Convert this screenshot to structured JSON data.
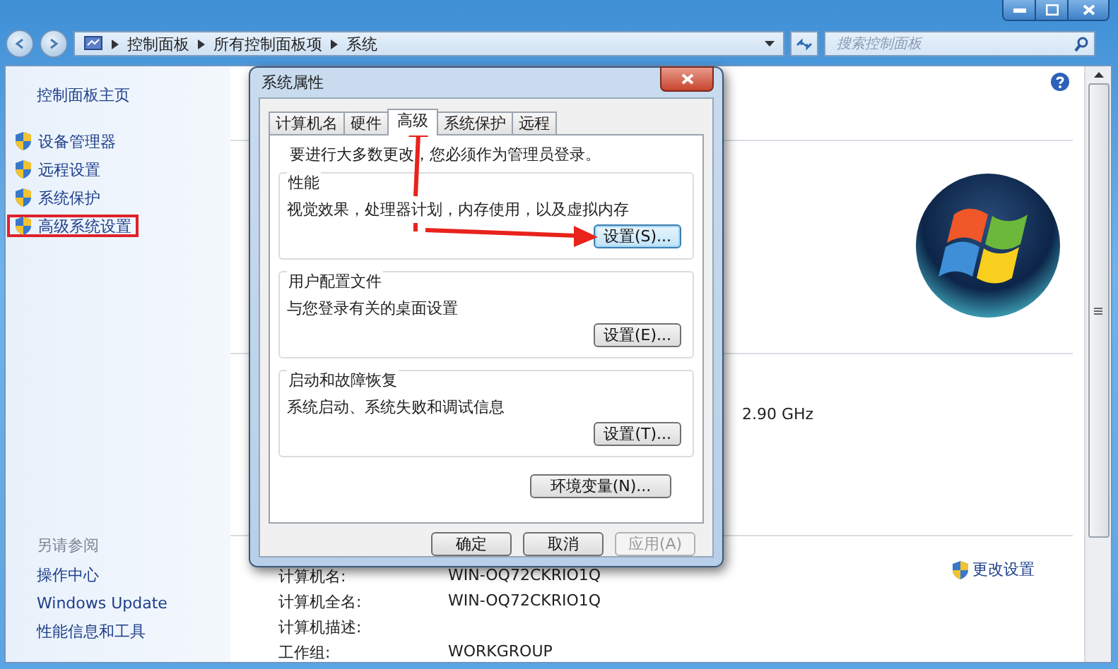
{
  "window": {
    "breadcrumb": [
      "控制面板",
      "所有控制面板项",
      "系统"
    ],
    "search": {
      "placeholder": "搜索控制面板"
    }
  },
  "sidebar": {
    "home": "控制面板主页",
    "items": [
      {
        "label": "设备管理器",
        "highlighted": false
      },
      {
        "label": "远程设置",
        "highlighted": false
      },
      {
        "label": "系统保护",
        "highlighted": false
      },
      {
        "label": "高级系统设置",
        "highlighted": true
      }
    ],
    "see_also": {
      "title": "另请参阅",
      "links": [
        "操作中心",
        "Windows Update",
        "性能信息和工具"
      ]
    }
  },
  "main": {
    "processor_speed": "2.90 GHz",
    "change_settings": "更改设置",
    "rows": [
      {
        "label": "计算机名:",
        "value": "WIN-OQ72CKRIO1Q"
      },
      {
        "label": "计算机全名:",
        "value": "WIN-OQ72CKRIO1Q"
      },
      {
        "label": "计算机描述:",
        "value": ""
      },
      {
        "label": "工作组:",
        "value": "WORKGROUP"
      }
    ]
  },
  "dialog": {
    "title": "系统属性",
    "tabs": [
      {
        "label": "计算机名",
        "selected": false
      },
      {
        "label": "硬件",
        "selected": false
      },
      {
        "label": "高级",
        "selected": true
      },
      {
        "label": "系统保护",
        "selected": false
      },
      {
        "label": "远程",
        "selected": false
      }
    ],
    "notice": "要进行大多数更改，您必须作为管理员登录。",
    "groups": [
      {
        "title": "性能",
        "description": "视觉效果，处理器计划，内存使用，以及虚拟内存",
        "button": "设置(S)...",
        "focused": true
      },
      {
        "title": "用户配置文件",
        "description": "与您登录有关的桌面设置",
        "button": "设置(E)...",
        "focused": false
      },
      {
        "title": "启动和故障恢复",
        "description": "系统启动、系统失败和调试信息",
        "button": "设置(T)...",
        "focused": false
      }
    ],
    "env_button": "环境变量(N)...",
    "buttons": [
      {
        "label": "确定",
        "disabled": false
      },
      {
        "label": "取消",
        "disabled": false
      },
      {
        "label": "应用(A)",
        "disabled": true
      }
    ]
  }
}
